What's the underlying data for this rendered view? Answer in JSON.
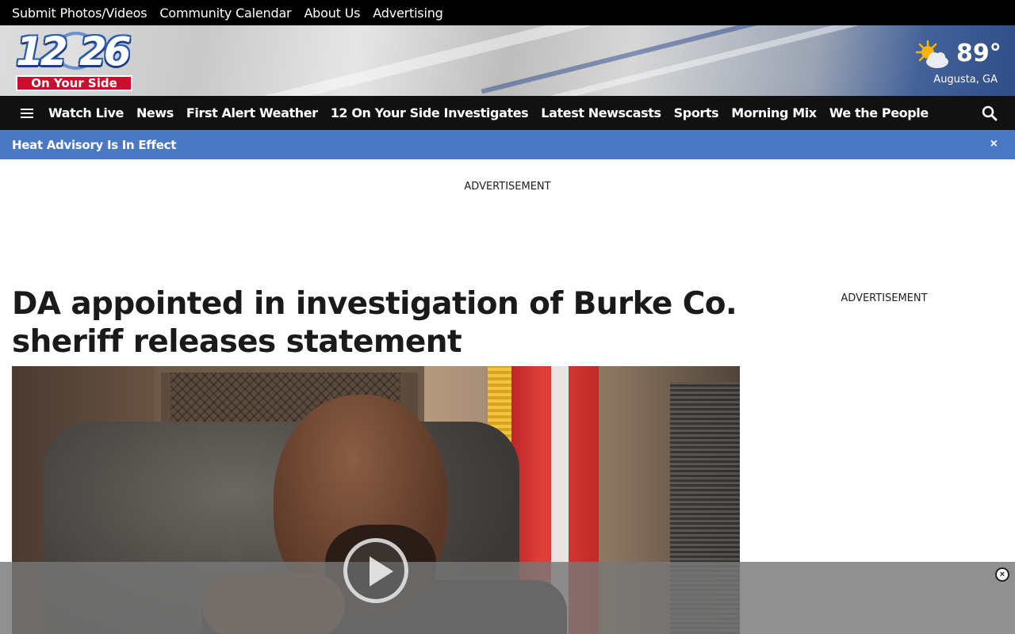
{
  "utility_nav": {
    "items": [
      "Submit Photos/Videos",
      "Community Calendar",
      "About Us",
      "Advertising"
    ]
  },
  "logo": {
    "number_left": "12",
    "number_right": "26",
    "tagline": "On Your Side"
  },
  "weather": {
    "icon": "partly-sunny-icon",
    "temperature": "89°",
    "location": "Augusta, GA"
  },
  "main_nav": {
    "items": [
      "Watch Live",
      "News",
      "First Alert Weather",
      "12 On Your Side Investigates",
      "Latest Newscasts",
      "Sports",
      "Morning Mix",
      "We the People"
    ]
  },
  "alert": {
    "text": "Heat Advisory Is In Effect",
    "close_label": "×"
  },
  "ads": {
    "top_label": "ADVERTISEMENT",
    "side_label": "ADVERTISEMENT"
  },
  "article": {
    "headline": "DA appointed in investigation of Burke Co. sheriff releases statement"
  },
  "video_overlay": {
    "close_label": "×"
  },
  "colors": {
    "utility_bg": "#000000",
    "nav_bg": "#111111",
    "alert_bg": "#4a78c2",
    "logo_red": "#c8102e"
  }
}
